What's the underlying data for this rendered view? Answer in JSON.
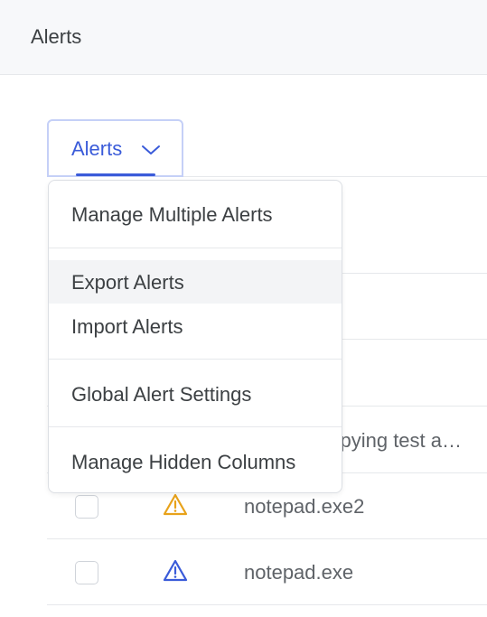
{
  "header": {
    "title": "Alerts"
  },
  "tab": {
    "label": "Alerts"
  },
  "menu": {
    "items": [
      {
        "label": "Manage Multiple Alerts"
      },
      {
        "label": "Export Alerts"
      },
      {
        "label": "Import Alerts"
      },
      {
        "label": "Global Alert Settings"
      },
      {
        "label": "Manage Hidden Columns"
      }
    ]
  },
  "table": {
    "rows": [
      {
        "name": "copying test a…",
        "icon": "warning-icon",
        "color": "#e8a21a"
      },
      {
        "name": "notepad.exe2",
        "icon": "warning-icon",
        "color": "#e8a21a"
      },
      {
        "name": "notepad.exe",
        "icon": "warning-icon",
        "color": "#3a5bd9"
      }
    ]
  },
  "colors": {
    "accent": "#3a5bd9",
    "warning": "#e8a21a"
  }
}
